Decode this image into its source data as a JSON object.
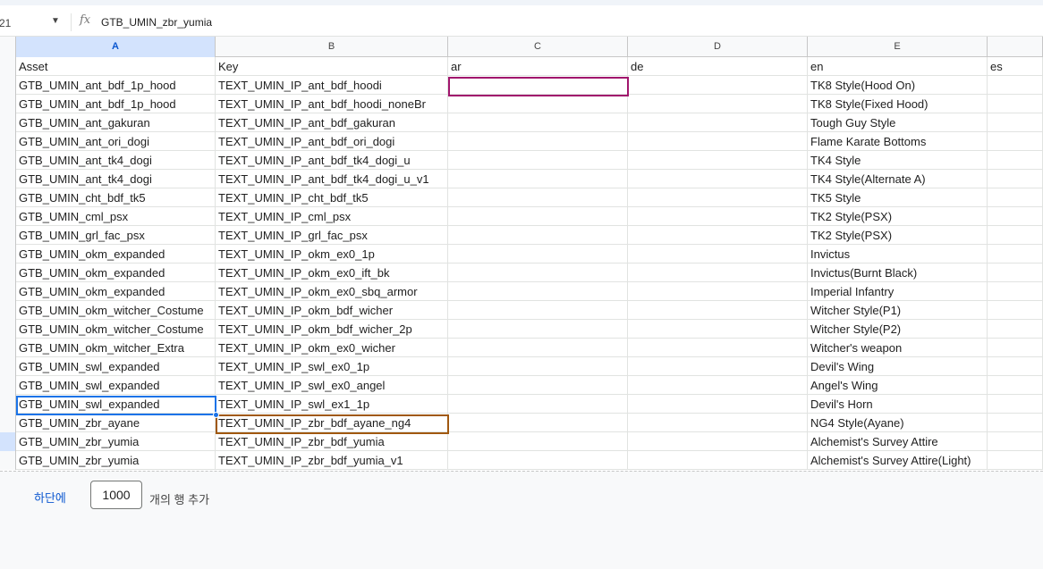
{
  "namebox": {
    "value": "21",
    "arrow": "▼"
  },
  "formula": {
    "icon": "fx",
    "value": "GTB_UMIN_zbr_yumia"
  },
  "columns": [
    "A",
    "B",
    "C",
    "D",
    "E",
    ""
  ],
  "selected_column": "A",
  "headers": [
    "Asset",
    "Key",
    "ar",
    "de",
    "en",
    "es"
  ],
  "rows": [
    [
      "GTB_UMIN_ant_bdf_1p_hood",
      "TEXT_UMIN_IP_ant_bdf_hoodi",
      "",
      "",
      "TK8 Style(Hood On)",
      ""
    ],
    [
      "GTB_UMIN_ant_bdf_1p_hood",
      "TEXT_UMIN_IP_ant_bdf_hoodi_noneBr",
      "",
      "",
      "TK8 Style(Fixed Hood)",
      ""
    ],
    [
      "GTB_UMIN_ant_gakuran",
      "TEXT_UMIN_IP_ant_bdf_gakuran",
      "",
      "",
      "Tough Guy Style",
      ""
    ],
    [
      "GTB_UMIN_ant_ori_dogi",
      "TEXT_UMIN_IP_ant_bdf_ori_dogi",
      "",
      "",
      "Flame Karate Bottoms",
      ""
    ],
    [
      "GTB_UMIN_ant_tk4_dogi",
      "TEXT_UMIN_IP_ant_bdf_tk4_dogi_u",
      "",
      "",
      "TK4 Style",
      ""
    ],
    [
      "GTB_UMIN_ant_tk4_dogi",
      "TEXT_UMIN_IP_ant_bdf_tk4_dogi_u_v1",
      "",
      "",
      "TK4 Style(Alternate A)",
      ""
    ],
    [
      "GTB_UMIN_cht_bdf_tk5",
      "TEXT_UMIN_IP_cht_bdf_tk5",
      "",
      "",
      "TK5 Style",
      ""
    ],
    [
      "GTB_UMIN_cml_psx",
      "TEXT_UMIN_IP_cml_psx",
      "",
      "",
      "TK2 Style(PSX)",
      ""
    ],
    [
      "GTB_UMIN_grl_fac_psx",
      "TEXT_UMIN_IP_grl_fac_psx",
      "",
      "",
      "TK2 Style(PSX)",
      ""
    ],
    [
      "GTB_UMIN_okm_expanded",
      "TEXT_UMIN_IP_okm_ex0_1p",
      "",
      "",
      "Invictus",
      ""
    ],
    [
      "GTB_UMIN_okm_expanded",
      "TEXT_UMIN_IP_okm_ex0_ift_bk",
      "",
      "",
      "Invictus(Burnt Black)",
      ""
    ],
    [
      "GTB_UMIN_okm_expanded",
      "TEXT_UMIN_IP_okm_ex0_sbq_armor",
      "",
      "",
      "Imperial Infantry",
      ""
    ],
    [
      "GTB_UMIN_okm_witcher_Costume",
      "TEXT_UMIN_IP_okm_bdf_wicher",
      "",
      "",
      "Witcher Style(P1)",
      ""
    ],
    [
      "GTB_UMIN_okm_witcher_Costume",
      "TEXT_UMIN_IP_okm_bdf_wicher_2p",
      "",
      "",
      "Witcher Style(P2)",
      ""
    ],
    [
      "GTB_UMIN_okm_witcher_Extra",
      "TEXT_UMIN_IP_okm_ex0_wicher",
      "",
      "",
      "Witcher's weapon",
      ""
    ],
    [
      "GTB_UMIN_swl_expanded",
      "TEXT_UMIN_IP_swl_ex0_1p",
      "",
      "",
      "Devil's Wing",
      ""
    ],
    [
      "GTB_UMIN_swl_expanded",
      "TEXT_UMIN_IP_swl_ex0_angel",
      "",
      "",
      "Angel's Wing",
      ""
    ],
    [
      "GTB_UMIN_swl_expanded",
      "TEXT_UMIN_IP_swl_ex1_1p",
      "",
      "",
      "Devil's Horn",
      ""
    ],
    [
      "GTB_UMIN_zbr_ayane",
      "TEXT_UMIN_IP_zbr_bdf_ayane_ng4",
      "",
      "",
      "NG4 Style(Ayane)",
      ""
    ],
    [
      "GTB_UMIN_zbr_yumia",
      "TEXT_UMIN_IP_zbr_bdf_yumia",
      "",
      "",
      "Alchemist's Survey Attire",
      ""
    ],
    [
      "GTB_UMIN_zbr_yumia",
      "TEXT_UMIN_IP_zbr_bdf_yumia_v1",
      "",
      "",
      "Alchemist's Survey Attire(Light)",
      ""
    ]
  ],
  "footer": {
    "link": "하단에",
    "count": "1000",
    "label": "개의 행 추가"
  },
  "colors": {
    "selection": "#1a73e8",
    "collab_c": "#a1166d",
    "collab_b": "#a0580f"
  }
}
